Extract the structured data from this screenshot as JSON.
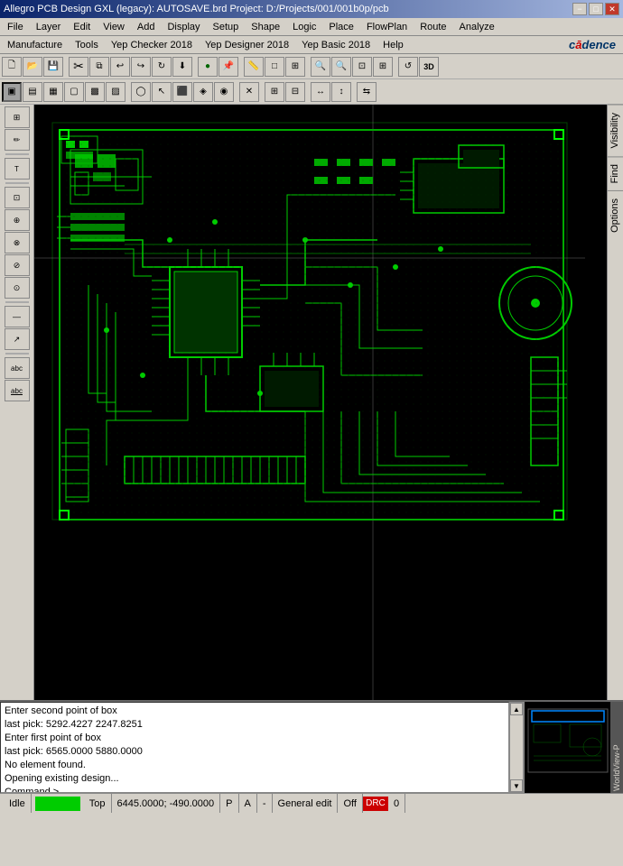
{
  "titlebar": {
    "title": "Allegro PCB Design GXL (legacy): AUTOSAVE.brd  Project: D:/Projects/001/001b0p/pcb",
    "icon": "pcb-icon",
    "min_label": "−",
    "max_label": "□",
    "close_label": "✕"
  },
  "menubar1": {
    "items": [
      "File",
      "Layer",
      "Edit",
      "View",
      "Add",
      "Display",
      "Setup",
      "Shape",
      "Logic",
      "Place",
      "FlowPlan",
      "Route",
      "Analyze"
    ]
  },
  "menubar2": {
    "items": [
      "Manufacture",
      "Tools",
      "Yep Checker 2018",
      "Yep Designer 2018",
      "Yep Basic 2018",
      "Help"
    ],
    "logo": "cadence"
  },
  "toolbar1": {
    "buttons": [
      "📁",
      "📂",
      "💾",
      "✂",
      "📋",
      "↩",
      "↪",
      "↻",
      "⬇",
      "🔘",
      "📌",
      "📐",
      "□",
      "⊞",
      "🔍+",
      "🔍-",
      "🔍",
      "🔍",
      "↺",
      "3D"
    ]
  },
  "toolbar2": {
    "buttons": [
      "▣",
      "▤",
      "▦",
      "▢",
      "▩",
      "▨",
      "◯",
      "↖",
      "⬛",
      "◈",
      "◉",
      "✕",
      "⊞",
      "⊟",
      "↔"
    ]
  },
  "left_toolbar": {
    "buttons": [
      "⊞",
      "✏",
      "〒",
      "abc",
      "⊡",
      "⊕",
      "⊗",
      "⊘",
      "⊙",
      "—",
      "abc",
      "abc"
    ]
  },
  "right_panel": {
    "tabs": [
      "Visibility",
      "Find",
      "Options"
    ]
  },
  "command_log": {
    "lines": [
      "Enter second point of box",
      "last pick:  5292.4227 2247.8251",
      "Enter first point of box",
      "last pick:  6565.0000 5880.0000",
      "No element found.",
      "Opening existing design...",
      "Command >"
    ]
  },
  "worldview": {
    "label": "WorldView-P"
  },
  "statusbar": {
    "idle_label": "Idle",
    "status_color": "#00cc00",
    "layer_label": "Top",
    "coordinates": "6445.0000; -490.0000",
    "coord_unit": "P",
    "coord_flag": "A",
    "dash": "-",
    "mode_label": "General edit",
    "off_label": "Off",
    "error_label": "DRC",
    "number_label": "0"
  }
}
